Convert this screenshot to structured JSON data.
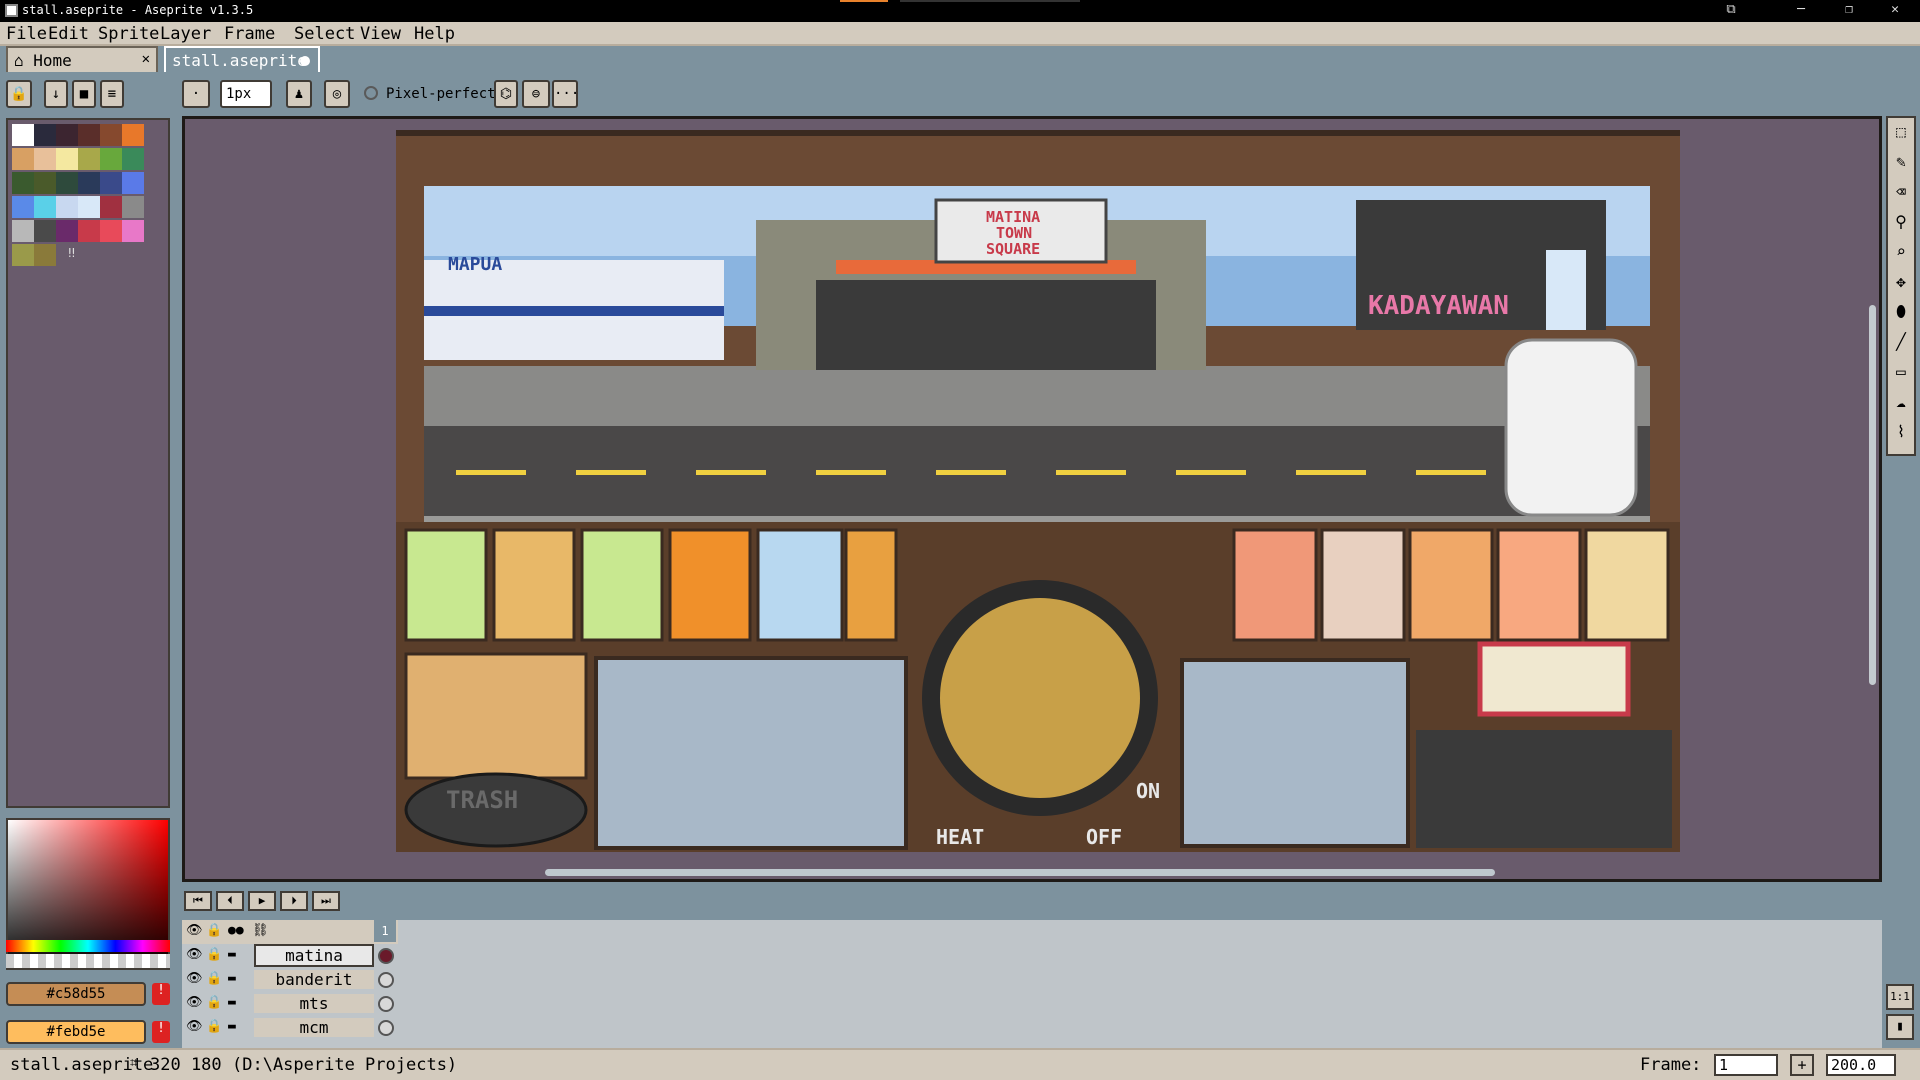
{
  "window": {
    "title": "stall.aseprite - Aseprite v1.3.5",
    "min": "─",
    "max": "❐",
    "close": "✕",
    "restore": "⧉"
  },
  "menu": {
    "items": [
      "File",
      "Edit",
      "Sprite",
      "Layer",
      "Frame",
      "Select",
      "View",
      "Help"
    ]
  },
  "tabs": [
    {
      "label": "Home",
      "close": "✕"
    },
    {
      "label": "stall.aseprite"
    }
  ],
  "toolbar": {
    "brush_size": "1px",
    "pixel_perfect_label": "Pixel-perfect",
    "more": "···"
  },
  "palette": {
    "colors": [
      "#ffffff",
      "#2a2a3c",
      "#3c2530",
      "#5a2e2a",
      "#86492e",
      "#e8782a",
      "#d8a063",
      "#e8c09a",
      "#f4e8a0",
      "#a8a84a",
      "#68a83c",
      "#3a8a5a",
      "#3a5a2e",
      "#4a5a2a",
      "#2e4a3c",
      "#2a3a5a",
      "#3a4a8a",
      "#5a7ae8",
      "#5a8ae8",
      "#5ad0e8",
      "#c8d8f0",
      "#d8e8f8",
      "#a03040",
      "#8a8a8a",
      "#b8b8b8",
      "#4a4a4a",
      "#6a2a6a",
      "#c83a4a",
      "#e84a5a",
      "#e878c8",
      "#9a9a4a",
      "#8a7a3a"
    ],
    "more": "‼"
  },
  "colors": {
    "foreground": "#c58d55",
    "background": "#febd5e",
    "warn": "!"
  },
  "timeline": {
    "controls": [
      "⏮",
      "⏴",
      "▶",
      "⏵",
      "⏭"
    ],
    "frame_number": "1",
    "layers": [
      {
        "name": "matina",
        "selected": true
      },
      {
        "name": "banderit",
        "selected": false
      },
      {
        "name": "mts",
        "selected": false
      },
      {
        "name": "mcm",
        "selected": false
      }
    ]
  },
  "scene": {
    "sign_mapua": "MAPUA",
    "sign_town": [
      "MATINA",
      "TOWN",
      "SQUARE"
    ],
    "sign_kadayawan": "KADAYAWAN",
    "trash_label": "TRASH",
    "heat_label": "HEAT",
    "on_label": "ON",
    "off_label": "OFF"
  },
  "status": {
    "file": "stall.aseprite",
    "size": "320 180",
    "path": "(D:\\Asperite Projects)",
    "frame_label": "Frame:",
    "frame_value": "1",
    "zoom": "200.0",
    "plus": "+"
  }
}
